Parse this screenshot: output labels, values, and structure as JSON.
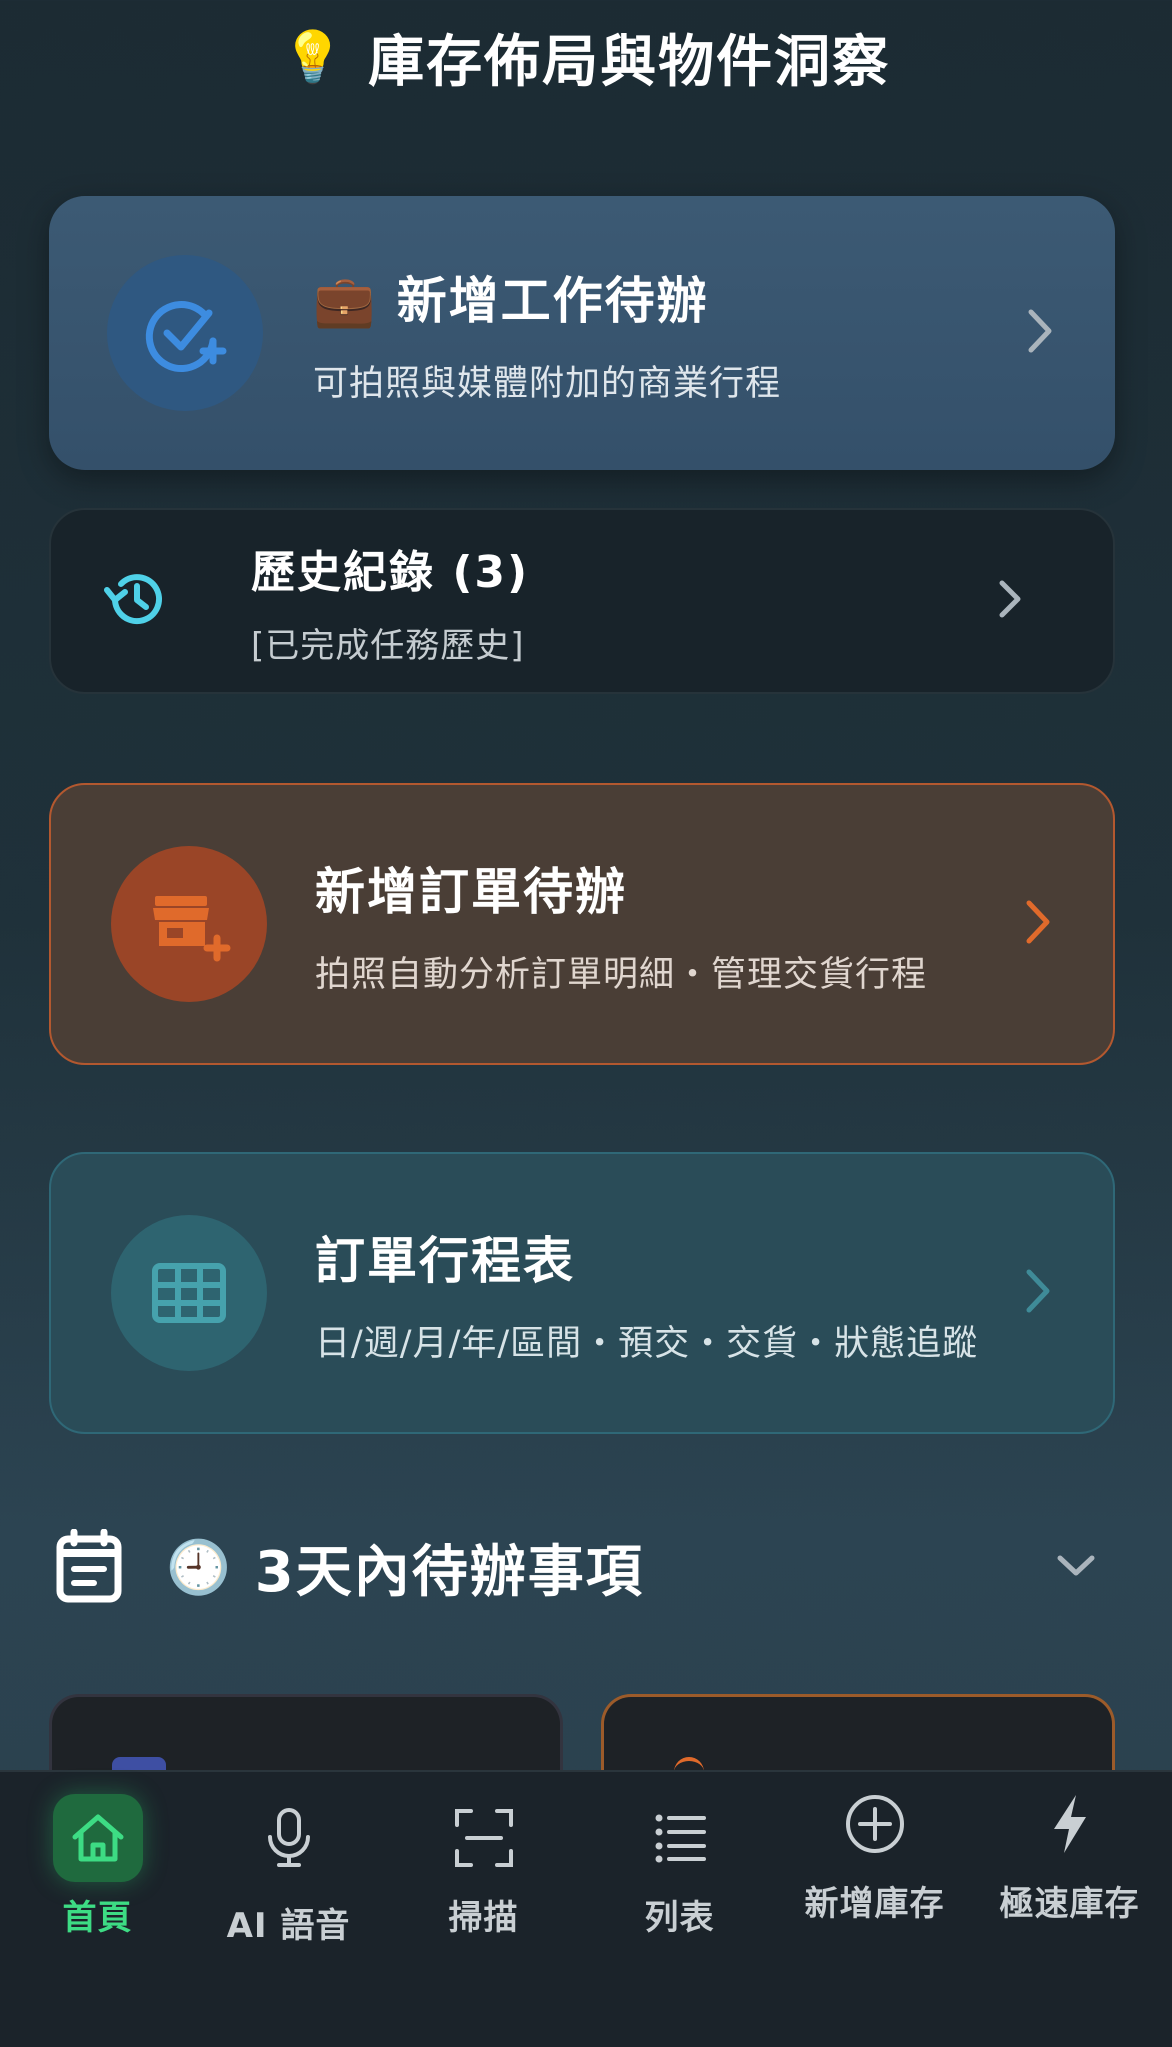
{
  "header": {
    "icon": "lightbulb-icon",
    "bulb": "💡",
    "title": "庫存佈局與物件洞察"
  },
  "cards": {
    "task": {
      "emoji": "💼",
      "title": "新增工作待辦",
      "subtitle": "可拍照與媒體附加的商業行程",
      "icon": "check-plus-icon",
      "accent": "#3d8ce0"
    },
    "history": {
      "title": "歷史紀錄 (3)",
      "subtitle": "[已完成任務歷史]",
      "icon": "history-icon",
      "accent": "#4fd1e8"
    },
    "order": {
      "title": "新增訂單待辦",
      "subtitle": "拍照自動分析訂單明細・管理交貨行程",
      "icon": "store-plus-icon",
      "accent": "#e06a2b"
    },
    "schedule": {
      "title": "訂單行程表",
      "subtitle": "日/週/月/年/區間・預交・交貨・狀態追蹤",
      "icon": "grid-calendar-icon",
      "accent": "#3f8b98"
    }
  },
  "section": {
    "icon": "calendar-icon",
    "clock": "🕘",
    "title": "3天內待辦事項"
  },
  "tabs": [
    {
      "label": "首頁",
      "icon": "home-icon",
      "active": true
    },
    {
      "label": "AI 語音",
      "icon": "microphone-icon"
    },
    {
      "label": "掃描",
      "icon": "scan-icon"
    },
    {
      "label": "列表",
      "icon": "list-icon"
    },
    {
      "label": "新增庫存",
      "icon": "plus-circle-icon"
    },
    {
      "label": "極速庫存",
      "icon": "lightning-icon"
    }
  ],
  "colors": {
    "active_tab": "#3ddc84",
    "tab_inactive": "#c9cfd3"
  }
}
